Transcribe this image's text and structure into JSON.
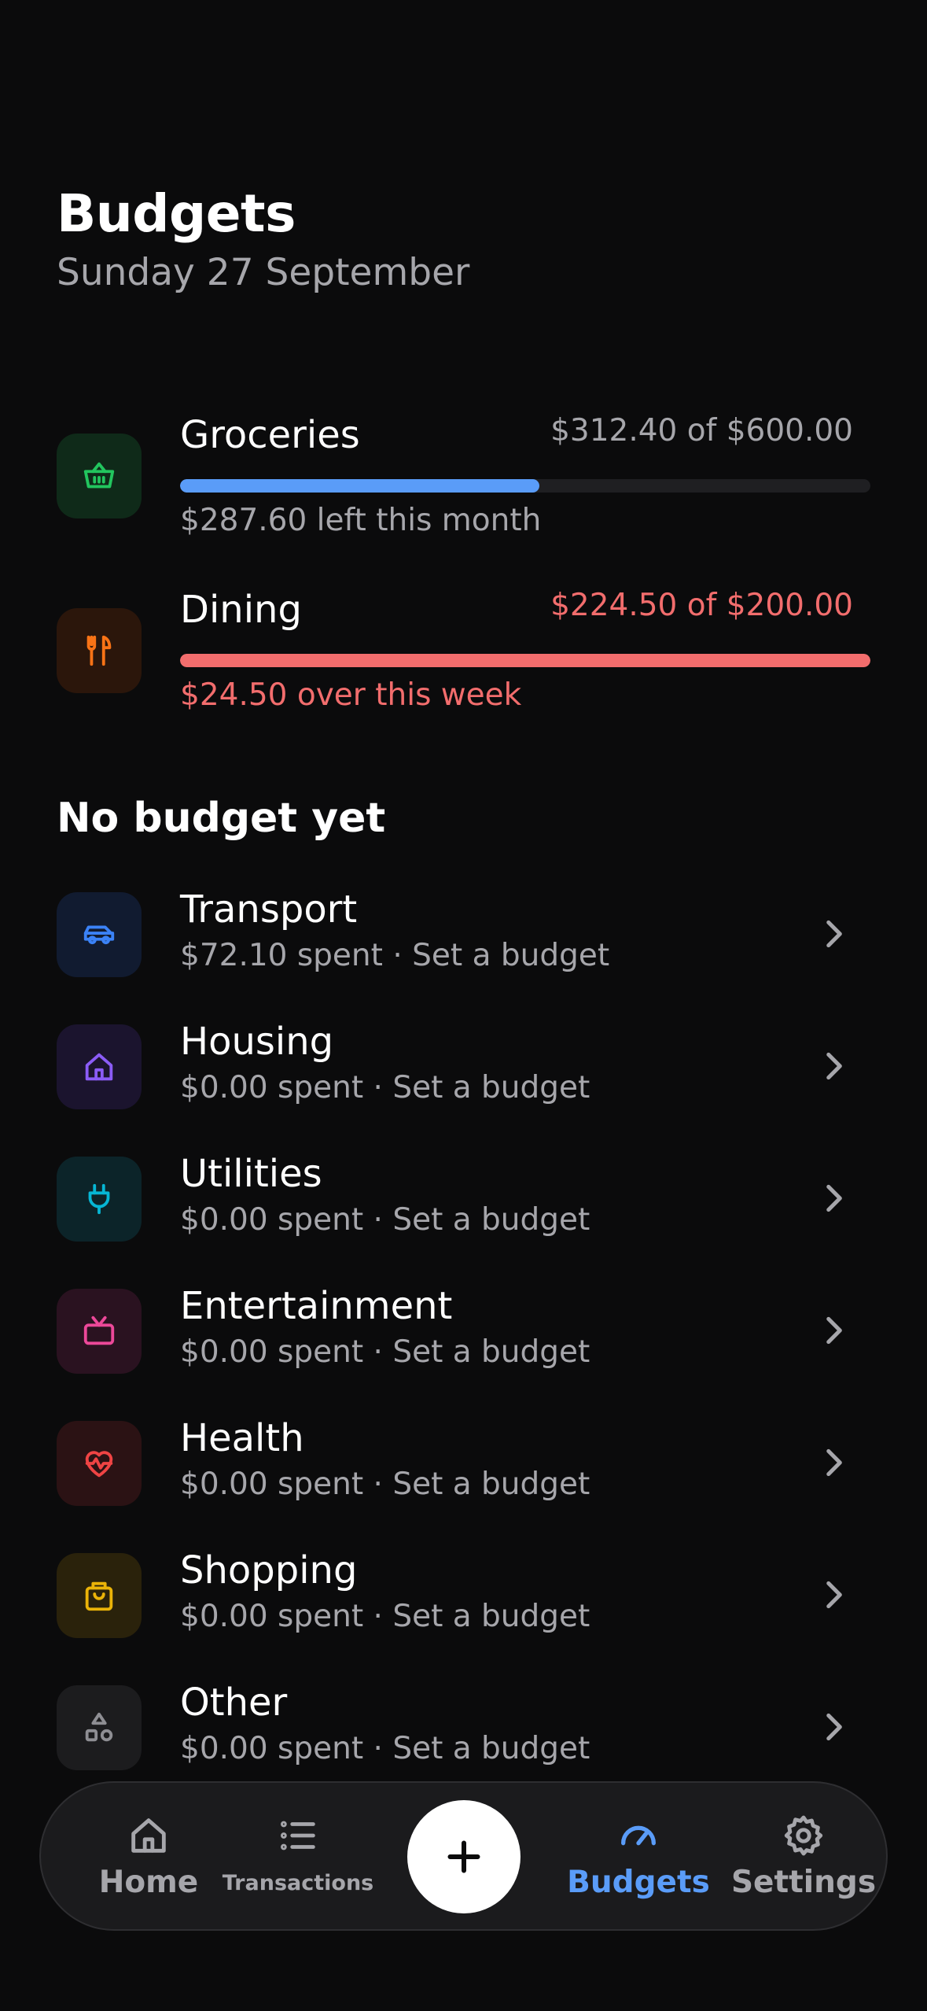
{
  "header": {
    "title": "Budgets",
    "date": "Sunday 27 September"
  },
  "budgets": [
    {
      "name": "Groceries",
      "amount": "$312.40 of $600.00",
      "note": "$287.60 left this month",
      "progress": 0.52,
      "icon": "basket-icon",
      "status": "under"
    },
    {
      "name": "Dining",
      "amount": "$224.50 of $200.00",
      "note": "$24.50 over this week",
      "progress": 1.0,
      "icon": "fork-knife-icon",
      "status": "over"
    }
  ],
  "unbudgeted": {
    "title": "No budget yet",
    "items": [
      {
        "name": "Transport",
        "sub": "$72.10 spent · Set a budget",
        "icon": "car-icon"
      },
      {
        "name": "Housing",
        "sub": "$0.00 spent · Set a budget",
        "icon": "house-icon"
      },
      {
        "name": "Utilities",
        "sub": "$0.00 spent · Set a budget",
        "icon": "plug-icon"
      },
      {
        "name": "Entertainment",
        "sub": "$0.00 spent · Set a budget",
        "icon": "tv-icon"
      },
      {
        "name": "Health",
        "sub": "$0.00 spent · Set a budget",
        "icon": "heart-pulse-icon"
      },
      {
        "name": "Shopping",
        "sub": "$0.00 spent · Set a budget",
        "icon": "shopping-bag-icon"
      },
      {
        "name": "Other",
        "sub": "$0.00 spent · Set a budget",
        "icon": "shapes-icon"
      }
    ]
  },
  "tabbar": {
    "home": "Home",
    "transactions": "Transactions",
    "budgets": "Budgets",
    "settings": "Settings",
    "active": "budgets"
  },
  "colors": {
    "background": "#0b0b0c",
    "accent_blue": "#5a9cf8",
    "over_red": "#f26d6d",
    "muted_text": "#a6a6ab",
    "groceries_green": "#22c55e",
    "dining_orange": "#f97316",
    "transport_blue": "#3b82f6",
    "housing_purple": "#8b5cf6",
    "utilities_cyan": "#06b6d4",
    "entertainment_pink": "#ec4899",
    "health_red": "#ef4444",
    "shopping_yellow": "#eab308",
    "other_gray": "#8e8e93"
  }
}
